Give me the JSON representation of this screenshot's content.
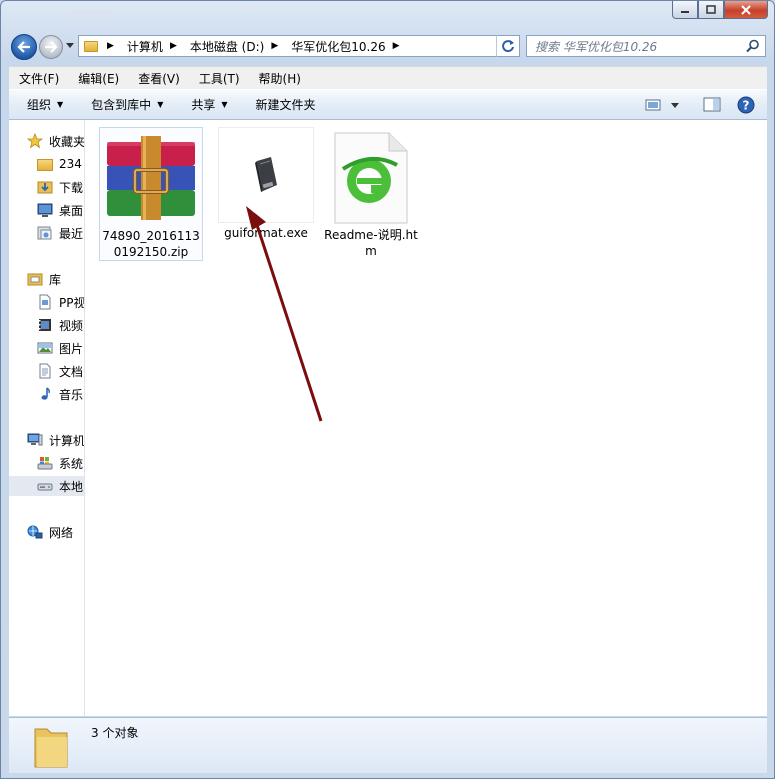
{
  "address": {
    "crumbs": [
      "计算机",
      "本地磁盘 (D:)",
      "华军优化包10.26"
    ]
  },
  "search": {
    "placeholder": "搜索 华军优化包10.26"
  },
  "menu": [
    "文件(F)",
    "编辑(E)",
    "查看(V)",
    "工具(T)",
    "帮助(H)"
  ],
  "commands": {
    "organize": "组织",
    "include_library": "包含到库中",
    "share": "共享",
    "new_folder": "新建文件夹"
  },
  "nav": {
    "favorites": "收藏夹",
    "fav_items": [
      "234",
      "下载",
      "桌面",
      "最近"
    ],
    "libraries": "库",
    "lib_items": [
      "PP视",
      "视频",
      "图片",
      "文档",
      "音乐"
    ],
    "computer": "计算机",
    "comp_items": [
      "系统",
      "本地"
    ],
    "network": "网络"
  },
  "files": [
    {
      "name": "74890_20161130192150.zip",
      "icon": "winrar-archive-icon"
    },
    {
      "name": "guiformat.exe",
      "icon": "usb-drive-icon"
    },
    {
      "name": "Readme-说明.htm",
      "icon": "ie-html-icon"
    }
  ],
  "status": {
    "count": "3 个对象"
  },
  "colors": {
    "accent": "#1f5aa8",
    "arrow": "#7a0d0d"
  }
}
